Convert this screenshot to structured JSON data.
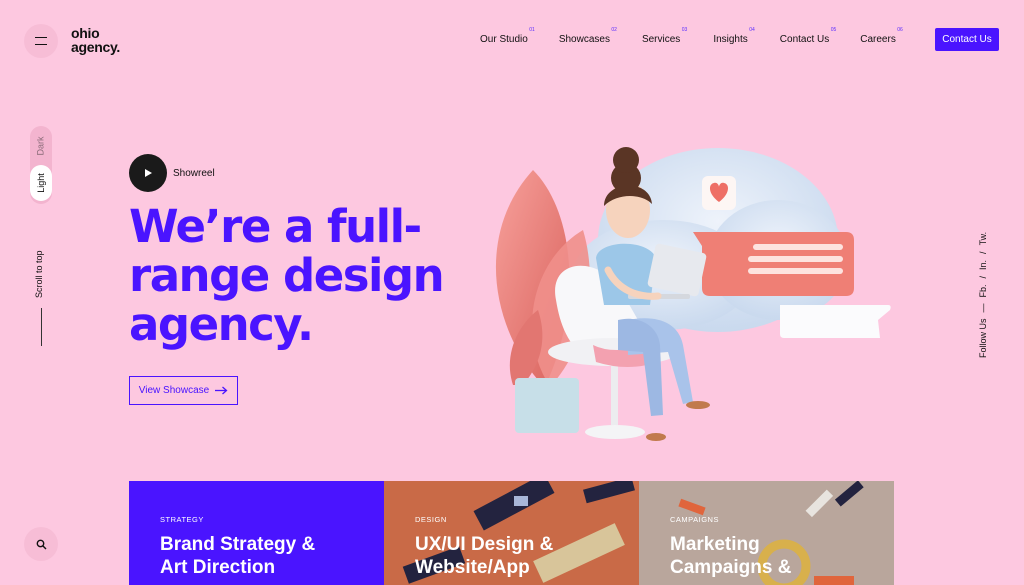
{
  "logo": {
    "line1": "ohio",
    "line2": "agency."
  },
  "nav": [
    {
      "label": "Our Studio",
      "num": "01"
    },
    {
      "label": "Showcases",
      "num": "02"
    },
    {
      "label": "Services",
      "num": "03"
    },
    {
      "label": "Insights",
      "num": "04"
    },
    {
      "label": "Contact Us",
      "num": "05"
    },
    {
      "label": "Careers",
      "num": "06"
    }
  ],
  "contact_button": "Contact Us",
  "mode": {
    "dark": "Dark",
    "light": "Light",
    "selected": "Light"
  },
  "scroll_to_top": "Scroll to top",
  "follow": {
    "label": "Follow Us",
    "dash": "—",
    "links": [
      "Fb.",
      "In.",
      "Tw."
    ],
    "sep": "/"
  },
  "hero": {
    "showreel": "Showreel",
    "headline": [
      "We’re a full-",
      "range design",
      "agency."
    ],
    "cta": "View Showcase"
  },
  "cards": [
    {
      "category": "STRATEGY",
      "title": [
        "Brand Strategy &",
        "Art Direction"
      ]
    },
    {
      "category": "DESIGN",
      "title": [
        "UX/UI Design &",
        "Website/App"
      ]
    },
    {
      "category": "CAMPAIGNS",
      "title": [
        "Marketing",
        "Campaigns &"
      ]
    }
  ],
  "colors": {
    "background": "#fdc8e0",
    "accent": "#4a14ff",
    "card1": "#4a14ff",
    "card2": "#c96a47",
    "card3": "#b9a69c"
  }
}
